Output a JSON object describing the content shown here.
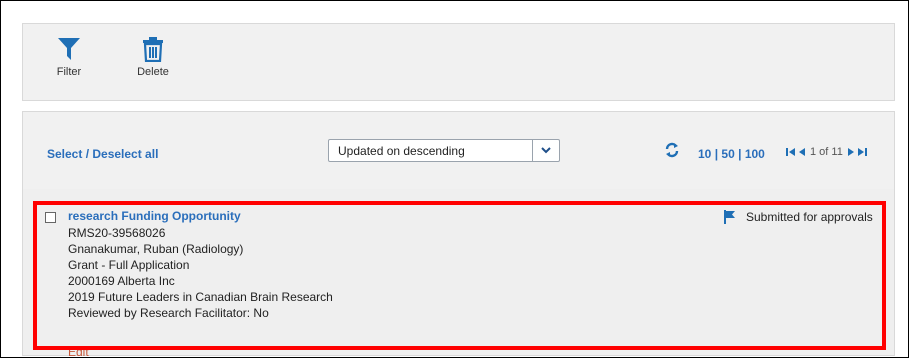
{
  "toolbar": {
    "filter_label": "Filter",
    "delete_label": "Delete"
  },
  "list_header": {
    "select_all": "Select / Deselect all",
    "sort_value": "Updated on descending",
    "page_sizes": [
      "10",
      "50",
      "100"
    ],
    "page_info": "1 of 11"
  },
  "row": {
    "title": "research Funding Opportunity",
    "lines": [
      "RMS20-39568026",
      "Gnanakumar, Ruban (Radiology)",
      "Grant - Full Application",
      "2000169 Alberta Inc",
      "2019 Future Leaders in Canadian Brain Research",
      "Reviewed by Research Facilitator: No"
    ],
    "edit_label": "Edit",
    "status": "Submitted for approvals"
  },
  "colors": {
    "link": "#2a6ebb",
    "highlight": "#ff0000",
    "panel": "#f1f1f1"
  },
  "icons": [
    "filter-icon",
    "trash-icon",
    "refresh-icon",
    "first-page-icon",
    "prev-page-icon",
    "next-page-icon",
    "last-page-icon",
    "flag-icon",
    "chevron-down-icon"
  ]
}
